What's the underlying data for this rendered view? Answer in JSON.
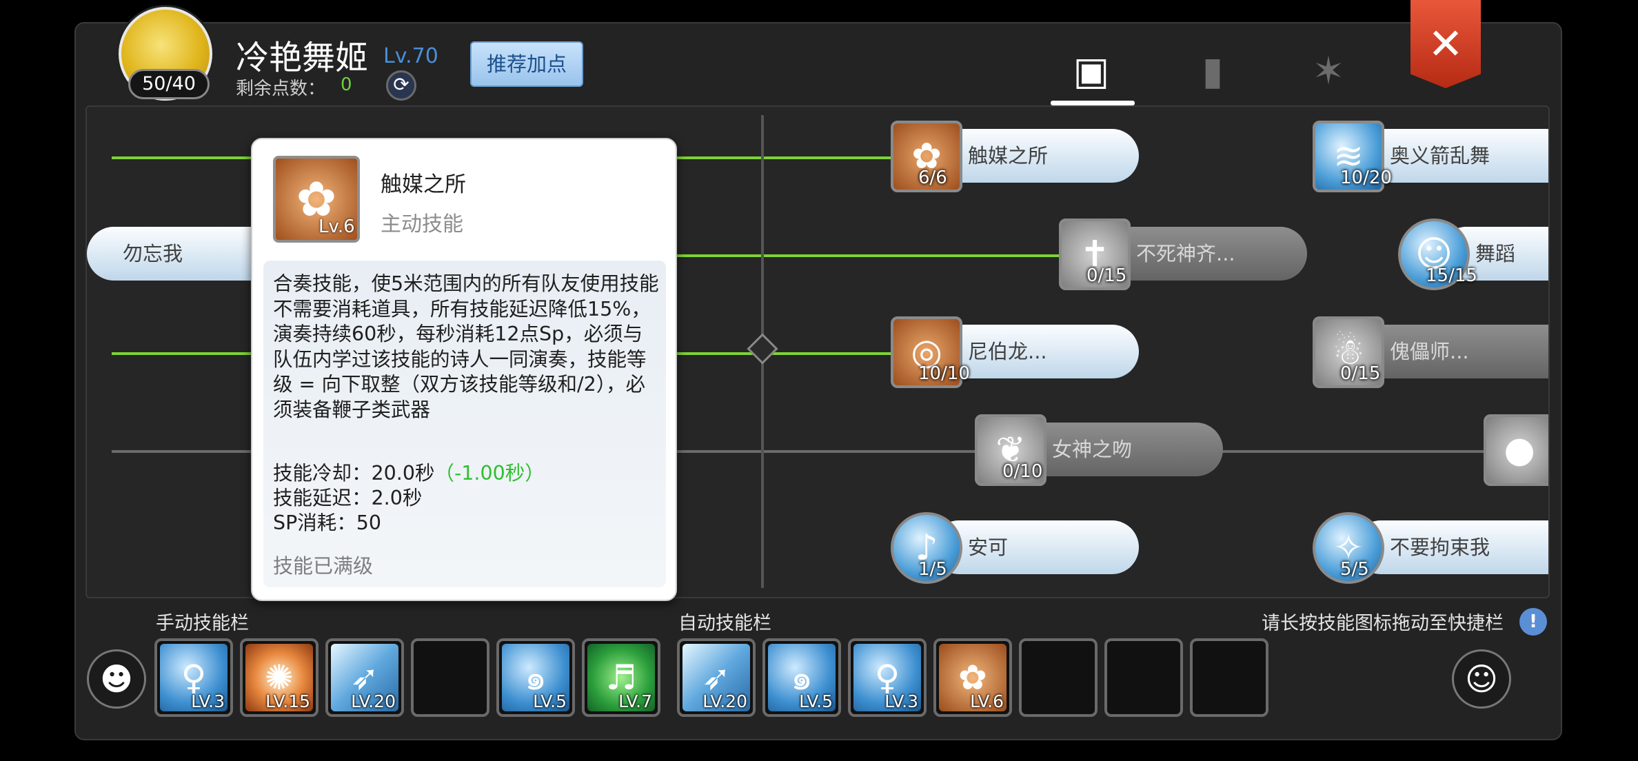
{
  "header": {
    "emblem_count": "50/40",
    "character_name": "冷艳舞姬",
    "level": "Lv.70",
    "remaining_points_label": "剩余点数：",
    "remaining_points": "0",
    "recommend_button": "推荐加点"
  },
  "tree": {
    "skills": [
      {
        "name": "触媒之所",
        "count": "6/6",
        "icon": "flower-icon",
        "active": true
      },
      {
        "name": "奥义箭乱舞",
        "count": "10/20",
        "icon": "arrow-storm-icon",
        "active": true
      },
      {
        "name": "勿忘我",
        "count": "",
        "icon": "",
        "active": true
      },
      {
        "name": "不死神齐...",
        "count": "0/15",
        "icon": "cross-icon",
        "active": false
      },
      {
        "name": "舞蹈",
        "count": "15/15",
        "icon": "dancer-icon",
        "active": true
      },
      {
        "name": "尼伯龙...",
        "count": "10/10",
        "icon": "ring-icon",
        "active": true
      },
      {
        "name": "傀儡师...",
        "count": "0/15",
        "icon": "puppet-icon",
        "active": false
      },
      {
        "name": "女神之吻",
        "count": "0/10",
        "icon": "kiss-icon",
        "active": false
      },
      {
        "name": "安可",
        "count": "1/5",
        "icon": "encore-icon",
        "active": true
      },
      {
        "name": "不要拘束我",
        "count": "5/5",
        "icon": "free-icon",
        "active": true
      }
    ]
  },
  "popup": {
    "title": "触媒之所",
    "type": "主动技能",
    "level": "Lv.6",
    "description": "合奏技能，使5米范围内的所有队友使用技能不需要消耗道具，所有技能延迟降低15%，演奏持续60秒，每秒消耗12点Sp，必须与队伍内学过该技能的诗人一同演奏，技能等级 = 向下取整（双方该技能等级和/2），必须装备鞭子类武器",
    "cooldown_label": "技能冷却：20.0秒",
    "cooldown_bonus": "（-1.00秒）",
    "delay": "技能延迟：2.0秒",
    "sp": "SP消耗：50",
    "maxed": "技能已满级"
  },
  "bottom": {
    "manual_label": "手动技能栏",
    "auto_label": "自动技能栏",
    "hint": "请长按技能图标拖动至快捷栏",
    "manual_slots": [
      {
        "level": "LV.3",
        "icon": "dancer-icon"
      },
      {
        "level": "LV.15",
        "icon": "fire-burst-icon"
      },
      {
        "level": "LV.20",
        "icon": "arrow-storm-icon"
      },
      {
        "level": "",
        "icon": ""
      },
      {
        "level": "LV.5",
        "icon": "swirl-icon"
      },
      {
        "level": "LV.7",
        "icon": "music-note-icon"
      }
    ],
    "auto_slots": [
      {
        "level": "LV.20",
        "icon": "arrow-storm-icon"
      },
      {
        "level": "LV.5",
        "icon": "swirl-icon"
      },
      {
        "level": "LV.3",
        "icon": "dancer-icon"
      },
      {
        "level": "LV.6",
        "icon": "flower-icon"
      },
      {
        "level": "",
        "icon": ""
      },
      {
        "level": "",
        "icon": ""
      },
      {
        "level": "",
        "icon": ""
      }
    ]
  },
  "colors": {
    "accent_green": "#7ed334",
    "level_blue": "#4a8fd9",
    "close_red": "#d9432a"
  }
}
